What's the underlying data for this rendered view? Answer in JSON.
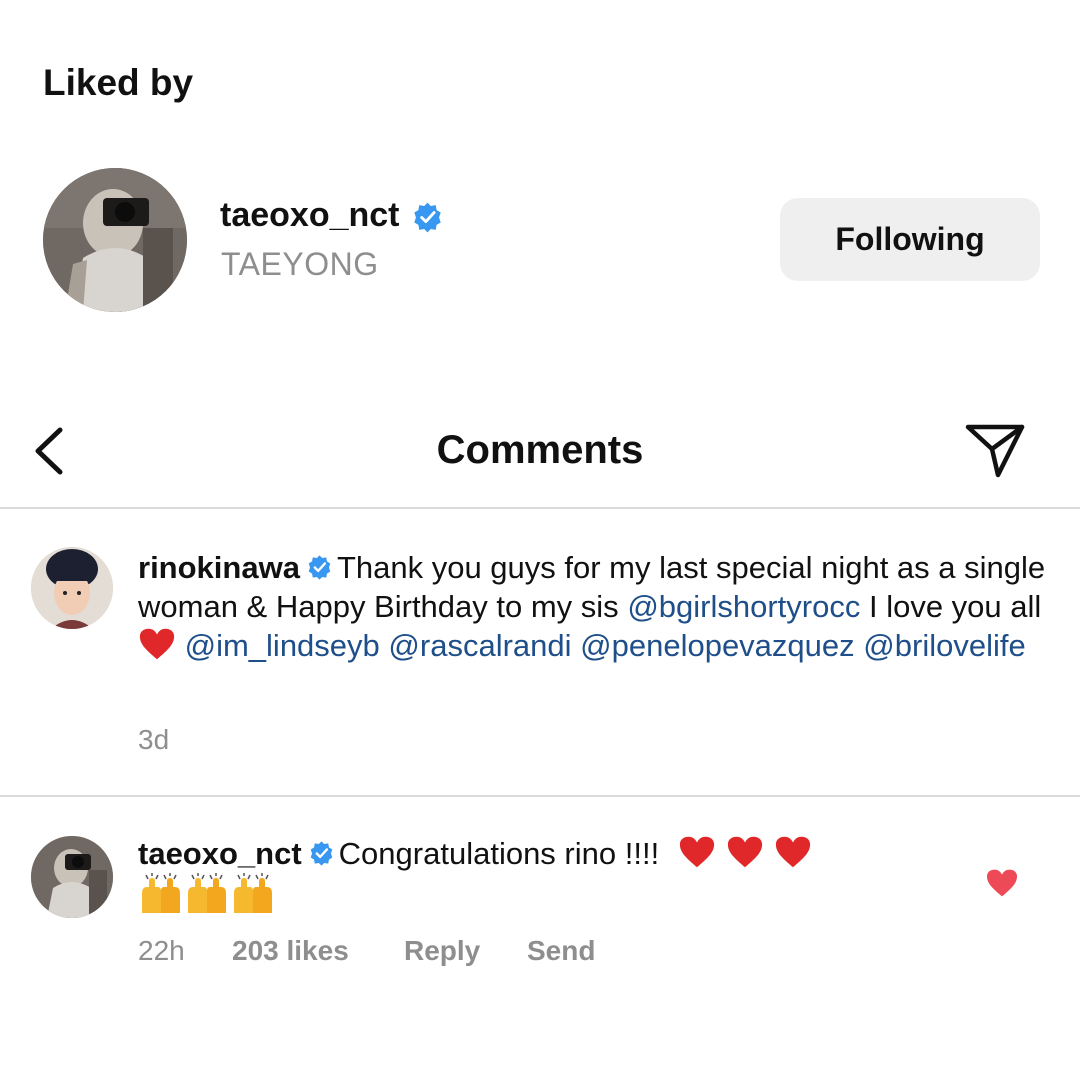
{
  "liked_by": {
    "title": "Liked by",
    "user": {
      "username": "taeoxo_nct",
      "full_name": "TAEYONG",
      "verified": true,
      "follow_button_label": "Following"
    }
  },
  "header": {
    "title": "Comments",
    "back_icon": "chevron-left-icon",
    "share_icon": "paper-plane-icon"
  },
  "comments": [
    {
      "username": "rinokinawa",
      "verified": true,
      "text_1": "Thank you guys for my last special night as a single woman & Happy Birthday to my sis",
      "mention_1": "@bgirlshortyrocc",
      "text_2": "I love you all",
      "mention_2": "@im_lindseyb",
      "mention_3": "@rascalrandi",
      "mention_4": "@penelopevazquez",
      "mention_5": "@brilovelife",
      "time": "3d"
    },
    {
      "username": "taeoxo_nct",
      "verified": true,
      "text": "Congratulations rino !!!!",
      "time": "22h",
      "likes": "203 likes",
      "reply_label": "Reply",
      "send_label": "Send",
      "liked": true
    }
  ],
  "colors": {
    "verified_blue": "#3897f0",
    "mention_blue": "#1f4f8a",
    "heart_red": "#ed4956",
    "secondary_text": "#8e8e8e",
    "button_bg": "#efefef"
  }
}
